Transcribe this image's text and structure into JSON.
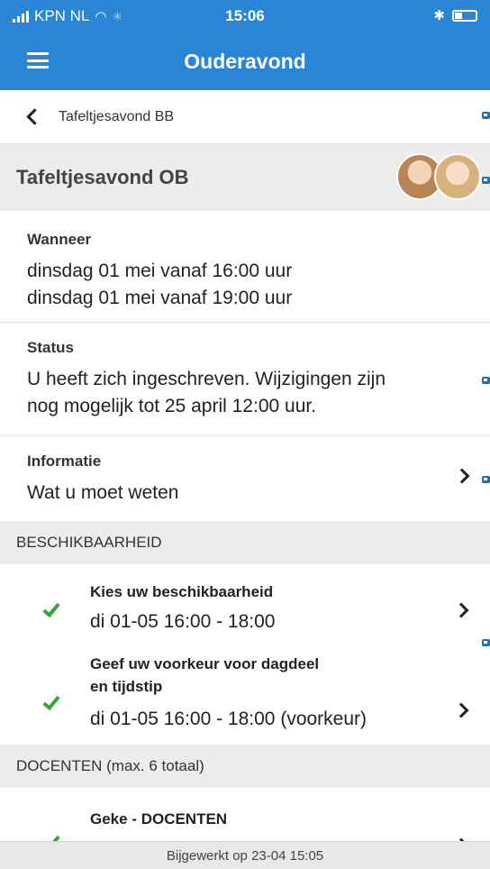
{
  "status_bar": {
    "carrier": "KPN NL",
    "time": "15:06"
  },
  "navbar": {
    "title": "Ouderavond"
  },
  "back": {
    "label": "Tafeltjesavond BB"
  },
  "event": {
    "title": "Tafeltjesavond OB"
  },
  "when": {
    "label": "Wanneer",
    "line1": "dinsdag 01 mei vanaf 16:00 uur",
    "line2": "dinsdag 01 mei vanaf 19:00 uur"
  },
  "status": {
    "label": "Status",
    "line1": "U heeft zich ingeschreven. Wijzigingen zijn",
    "line2": "nog mogelijk tot 25 april 12:00 uur."
  },
  "info": {
    "label": "Informatie",
    "value": "Wat u moet weten"
  },
  "availability": {
    "header": "BESCHIKBAARHEID",
    "items": [
      {
        "label": "Kies uw beschikbaarheid",
        "value": "di 01-05 16:00 - 18:00"
      },
      {
        "label_line1": "Geef uw voorkeur voor dagdeel",
        "label_line2": "en tijdstip",
        "value": "di 01-05 16:00 - 18:00 (voorkeur)"
      }
    ]
  },
  "teachers": {
    "header": "DOCENTEN (max. 6 totaal)",
    "items": [
      {
        "label": "Geke - DOCENTEN"
      }
    ]
  },
  "footer": {
    "updated": "Bijgewerkt op 23-04 15:05"
  },
  "colors": {
    "brand": "#2a86d4",
    "check": "#3aa63a",
    "section_bg": "#ececec"
  }
}
